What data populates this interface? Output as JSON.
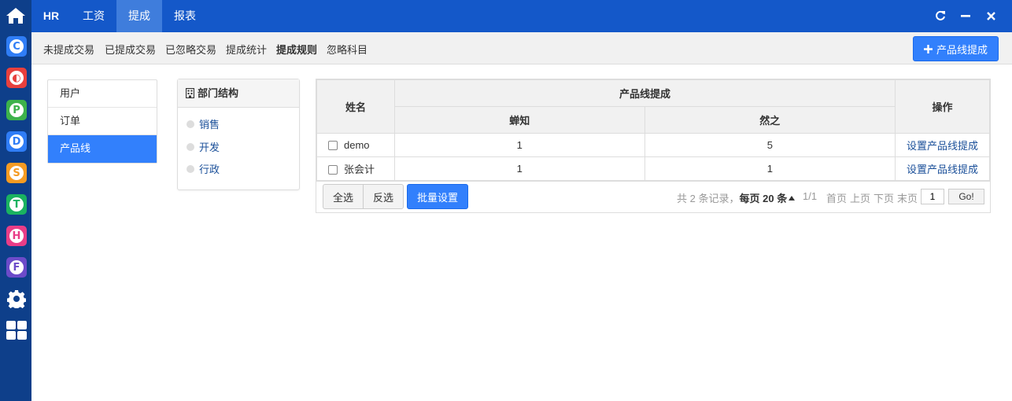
{
  "colors": {
    "dock_bg": "#0e3f8a",
    "topbar_bg": "#1458c9",
    "nav_active": "#3f7ddc",
    "primary": "#3280fc",
    "link": "#1a4f99"
  },
  "dock": {
    "apps": [
      {
        "icon": "letter-c-icon",
        "letter": "C",
        "color": "#2f7df6"
      },
      {
        "icon": "half-circle-icon",
        "letter": "◐",
        "color": "#e8403d"
      },
      {
        "icon": "letter-p-icon",
        "letter": "P",
        "color": "#3db24b"
      },
      {
        "icon": "letter-d-icon",
        "letter": "D",
        "color": "#2f7df6"
      },
      {
        "icon": "letter-s-icon",
        "letter": "S",
        "color": "#f59b22"
      },
      {
        "icon": "letter-t-icon",
        "letter": "T",
        "color": "#1ab260"
      },
      {
        "icon": "letter-h-icon",
        "letter": "H",
        "color": "#e93d87"
      },
      {
        "icon": "letter-f-icon",
        "letter": "F",
        "color": "#6c4bc9"
      }
    ]
  },
  "topnav": {
    "brand": "HR",
    "items": [
      "工资",
      "提成",
      "报表"
    ],
    "active": "提成"
  },
  "subnav": {
    "items": [
      "未提成交易",
      "已提成交易",
      "已忽略交易",
      "提成统计",
      "提成规则",
      "忽略科目"
    ],
    "active": "提成规则",
    "add_button": "产品线提成"
  },
  "side_menu": {
    "items": [
      "用户",
      "订单",
      "产品线"
    ],
    "active": "产品线"
  },
  "dept_panel": {
    "title": "部门结构",
    "items": [
      "销售",
      "开发",
      "行政"
    ]
  },
  "grid": {
    "col_name": "姓名",
    "col_group": "产品线提成",
    "col_op": "操作",
    "sub_cols": [
      "蝉知",
      "然之"
    ],
    "rows": [
      {
        "name": "demo",
        "values": [
          "1",
          "5"
        ],
        "op": "设置产品线提成"
      },
      {
        "name": "张会计",
        "values": [
          "1",
          "1"
        ],
        "op": "设置产品线提成"
      }
    ],
    "footer": {
      "select_all": "全选",
      "invert": "反选",
      "batch": "批量设置",
      "pager": {
        "summary_pre": "共",
        "total": "2",
        "summary_mid": "条记录，",
        "per_page_label": "每页",
        "per_page": "20",
        "per_page_unit": "条",
        "page_ratio": "1/1",
        "first": "首页",
        "prev": "上页",
        "next": "下页",
        "last": "末页",
        "current": "1",
        "go": "Go!"
      }
    }
  }
}
